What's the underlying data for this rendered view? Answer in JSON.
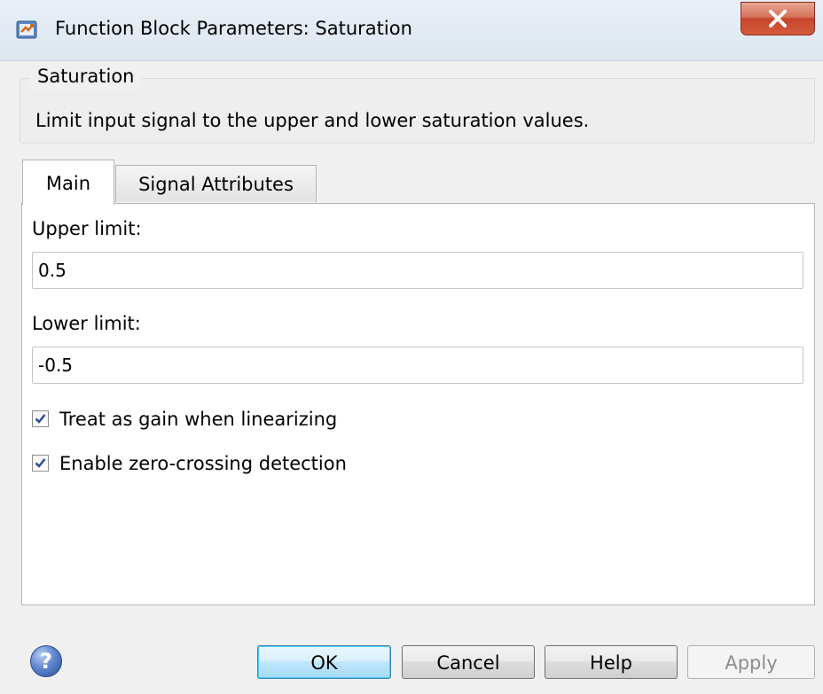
{
  "window": {
    "title": "Function Block Parameters: Saturation"
  },
  "block": {
    "name": "Saturation",
    "description": "Limit input signal to the upper and lower saturation values."
  },
  "tabs": [
    {
      "label": "Main",
      "selected": true
    },
    {
      "label": "Signal Attributes",
      "selected": false
    }
  ],
  "params": {
    "upper_limit_label": "Upper limit:",
    "upper_limit_value": "0.5",
    "lower_limit_label": "Lower limit:",
    "lower_limit_value": "-0.5",
    "linearize_label": "Treat as gain when linearizing",
    "linearize_checked": true,
    "zero_crossing_label": "Enable zero-crossing detection",
    "zero_crossing_checked": true
  },
  "buttons": {
    "ok": "OK",
    "cancel": "Cancel",
    "help": "Help",
    "apply": "Apply",
    "help_icon": "?"
  },
  "icons": {
    "app": "simulink-block-icon",
    "close": "close-icon",
    "help": "help-icon"
  },
  "colors": {
    "close_button": "#c6452c",
    "ok_border": "#3c7fb1",
    "help_icon": "#5f87cf"
  }
}
